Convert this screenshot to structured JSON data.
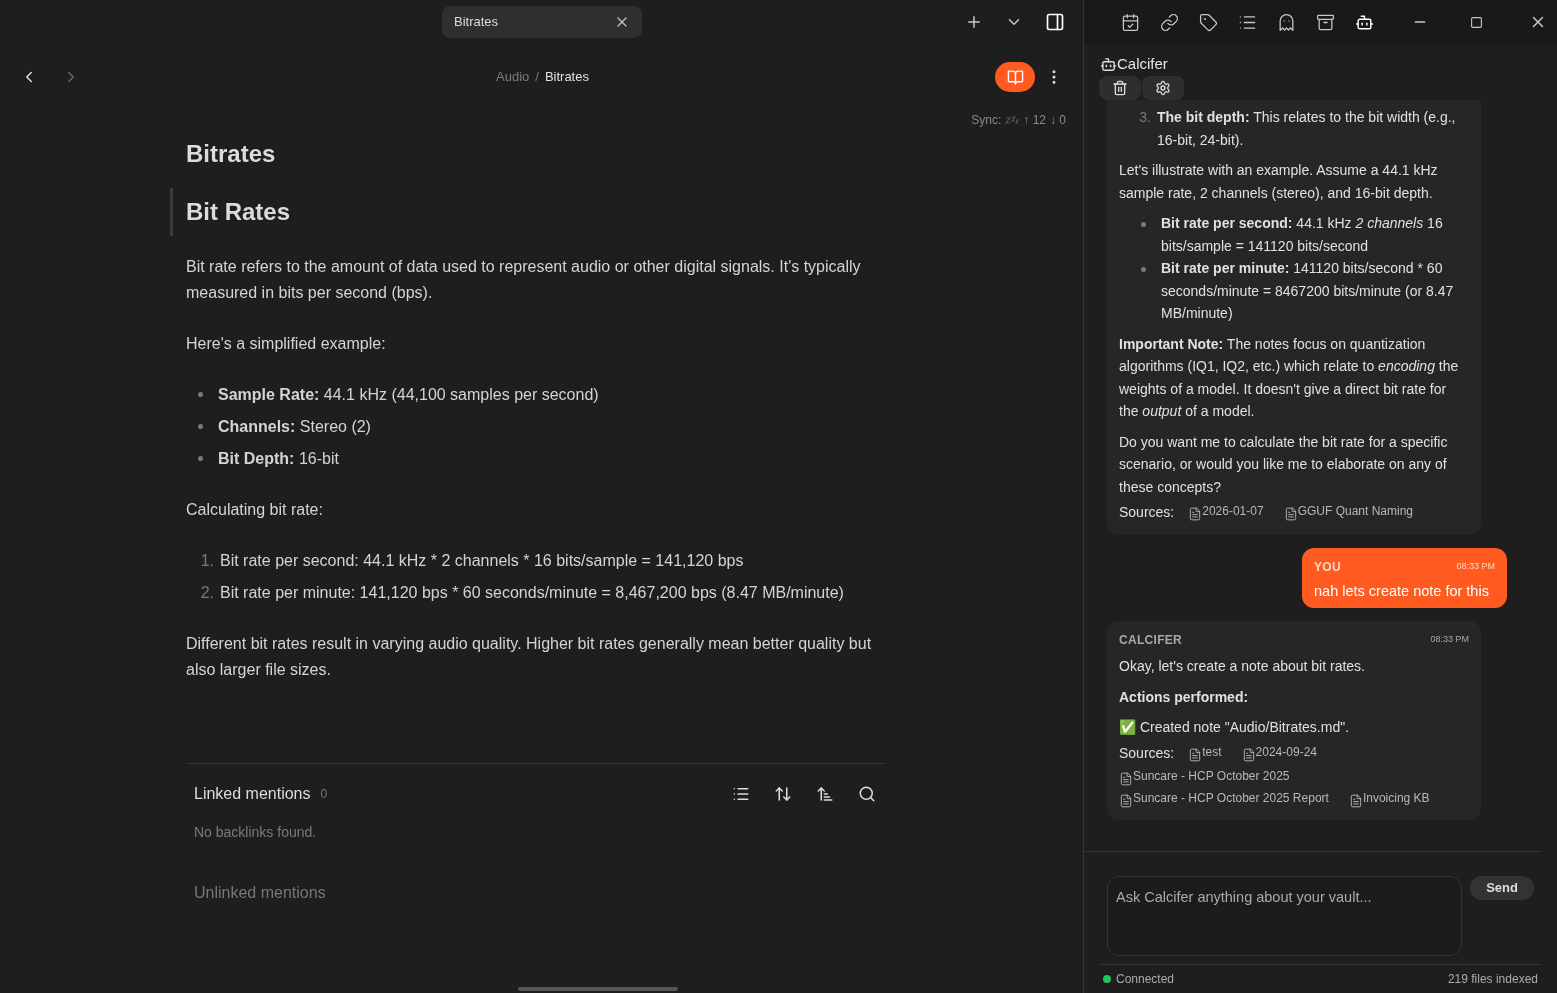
{
  "tab": {
    "title": "Bitrates"
  },
  "nav": {
    "breadcrumb": [
      "Audio",
      "Bitrates"
    ],
    "separator": "/",
    "sync": {
      "label": "Sync:",
      "up": "↑ 12",
      "down": "↓ 0"
    }
  },
  "note": {
    "title": "Bitrates",
    "blocks": [
      {
        "kind": "h1",
        "text": "Bit Rates"
      },
      {
        "kind": "p",
        "text": "Bit rate refers to the amount of data used to represent audio or other digital signals. It's typically measured in bits per second (bps)."
      },
      {
        "kind": "p",
        "text": "Here's a simplified example:"
      },
      {
        "kind": "ul",
        "items": [
          {
            "text": "**Sample Rate:** 44.1 kHz (44,100 samples per second)"
          },
          {
            "text": "**Channels:** Stereo (2)"
          },
          {
            "text": "**Bit Depth:** 16-bit"
          }
        ]
      },
      {
        "kind": "p",
        "text": "Calculating bit rate:"
      },
      {
        "kind": "ol",
        "items": [
          {
            "marker": "1.",
            "text": "Bit rate per second: 44.1 kHz * 2 channels * 16 bits/sample = 141,120 bps"
          },
          {
            "marker": "2.",
            "text": "Bit rate per minute: 141,120 bps * 60 seconds/minute = 8,467,200 bps (8.47 MB/minute)"
          }
        ]
      },
      {
        "kind": "p",
        "text": "Different bit rates result in varying audio quality. Higher bit rates generally mean better quality but also larger file sizes."
      }
    ]
  },
  "mentions": {
    "linked": {
      "title": "Linked mentions",
      "count": "0",
      "empty": "No backlinks found."
    },
    "unlinked": {
      "title": "Unlinked mentions"
    }
  },
  "chat": {
    "title": "Calcifer",
    "messages": [
      {
        "kind": "assistant",
        "blocks": [
          {
            "kind": "ol",
            "items": [
              {
                "marker": "3.",
                "text": "**The bit depth:** This relates to the bit width (e.g., 16-bit, 24-bit)."
              }
            ]
          },
          {
            "kind": "p",
            "text": "Let's illustrate with an example. Assume a 44.1 kHz sample rate, 2 channels (stereo), and 16-bit depth."
          },
          {
            "kind": "ul",
            "items": [
              {
                "text": "**Bit rate per second:** 44.1 kHz *2 channels* 16 bits/sample = 141120 bits/second"
              },
              {
                "text": "**Bit rate per minute:** 141120 bits/second * 60 seconds/minute = 8467200 bits/minute (or 8.47 MB/minute)"
              }
            ]
          },
          {
            "kind": "p",
            "text": "**Important Note:** The notes focus on quantization algorithms (IQ1, IQ2, etc.) which relate to *encoding* the weights of a model. It doesn't give a direct bit rate for the *output* of a model."
          },
          {
            "kind": "p",
            "text": "Do you want me to calculate the bit rate for a specific scenario, or would you like me to elaborate on any of these concepts?"
          }
        ],
        "sources": {
          "label": "Sources:",
          "items": [
            "2026-01-07",
            "GGUF Quant Naming"
          ]
        }
      },
      {
        "kind": "user",
        "author": "YOU",
        "time": "08:33 PM",
        "blocks": [
          {
            "kind": "p",
            "text": "nah lets create note for this"
          }
        ]
      },
      {
        "kind": "assistant",
        "author": "CALCIFER",
        "time": "08:33 PM",
        "blocks": [
          {
            "kind": "p",
            "text": "Okay, let's create a note about bit rates."
          },
          {
            "kind": "p",
            "text": "**Actions performed:**"
          },
          {
            "kind": "p",
            "text": "✅ Created note \"Audio/Bitrates.md\"."
          }
        ],
        "sources": {
          "label": "Sources:",
          "items": [
            "test",
            "2024-09-24",
            "Suncare - HCP October 2025",
            "Suncare - HCP October 2025 Report",
            "Invoicing KB"
          ]
        }
      }
    ],
    "input": {
      "placeholder": "Ask Calcifer anything about your vault..."
    },
    "send": "Send",
    "status": {
      "connected": true,
      "label": "Connected",
      "files": "219 files indexed"
    }
  }
}
